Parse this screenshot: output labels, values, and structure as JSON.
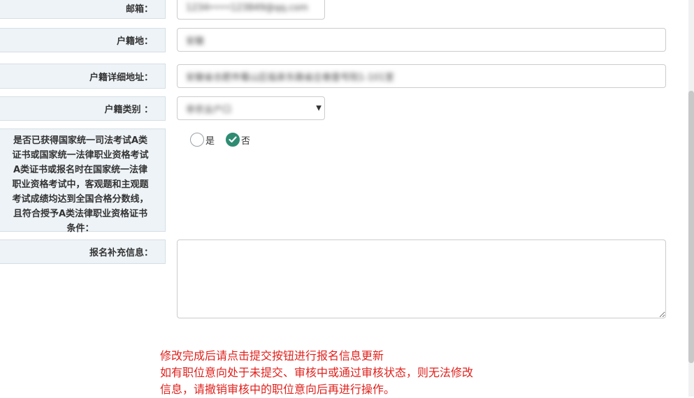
{
  "form": {
    "email": {
      "label": "邮箱：",
      "value": "1234••••123849@qq.com"
    },
    "household_register": {
      "label": "户籍地：",
      "value": "安徽"
    },
    "household_address": {
      "label": "户籍详细地址：",
      "value": "安徽省合肥市蜀山区临泉东路省庄巷壹号院1-101室"
    },
    "household_type": {
      "label": "户籍类别 ：",
      "value": "非农业户口"
    },
    "qualification": {
      "label_lines": [
        "是否已获得国家统一司法考试A类",
        "证书或国家统一法律职业资格考试",
        "A类证书或报名时在国家统一法律",
        "职业资格考试中，客观题和主观题",
        "考试成绩均达到全国合格分数线，",
        "且符合授予A类法律职业资格证书",
        "条件："
      ],
      "options": [
        {
          "label": "是",
          "checked": false
        },
        {
          "label": "否",
          "checked": true
        }
      ]
    },
    "supplement": {
      "label": "报名补充信息：",
      "value": ""
    }
  },
  "notice": {
    "lines": [
      "修改完成后请点击提交按钮进行报名信息更新",
      "如有职位意向处于未提交、审核中或通过审核状态，则无法修改",
      "信息，请撤销审核中的职位意向后再进行操作。"
    ],
    "color": "#e0211c"
  },
  "colors": {
    "accent": "#2f8c73",
    "label_bg": "#eef3f7"
  }
}
